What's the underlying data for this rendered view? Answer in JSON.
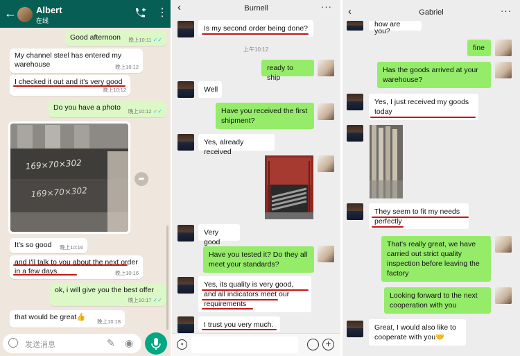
{
  "whatsapp": {
    "contact_name": "Albert",
    "status": "在线",
    "input_placeholder": "发送消息",
    "messages": [
      {
        "text": "Good afternoon",
        "time": "晚上10:11"
      },
      {
        "text": "My channel steel has entered my warehouse",
        "time": "晚上10:12"
      },
      {
        "text": "I checked it out and it's very good",
        "time": "晚上10:12"
      },
      {
        "text": "Do you have a photo",
        "time": "晚上10:12"
      },
      {
        "text": "It's so good",
        "time": "晚上10:16"
      },
      {
        "text": "and I'll talk to you about the next order in a few days.",
        "time": "晚上10:16"
      },
      {
        "text": "ok, i will give you the best offer",
        "time": "晚上10:17"
      },
      {
        "text": "that would be great👍",
        "time": "晚上10:18"
      }
    ]
  },
  "burnell": {
    "title": "Burnell",
    "timestamp": "上午10:12",
    "messages": [
      "Is my second order being done?",
      "ready to ship",
      "Well",
      "Have you received the first shipment?",
      "Yes, already received",
      "Very good",
      "Have you tested it? Do they all meet your standards?",
      "Yes, its quality is very good, and all indicators meet our requirements",
      "I trust you very much."
    ]
  },
  "gabriel": {
    "title": "Gabriel",
    "messages": [
      "how are you?",
      "fine",
      "Has the goods arrived at your warehouse?",
      "Yes, I just received my goods today",
      "They seem to fit my needs perfectly",
      "That's really great, we have carried out strict quality inspection before leaving the factory",
      "Looking forward to the next cooperation with you",
      "Great, I would also like to cooperate with you🤝"
    ]
  },
  "colors": {
    "whatsapp_header": "#075e54",
    "whatsapp_out": "#dcf8c6",
    "wechat_out": "#95ec69",
    "underline": "#c81414"
  }
}
